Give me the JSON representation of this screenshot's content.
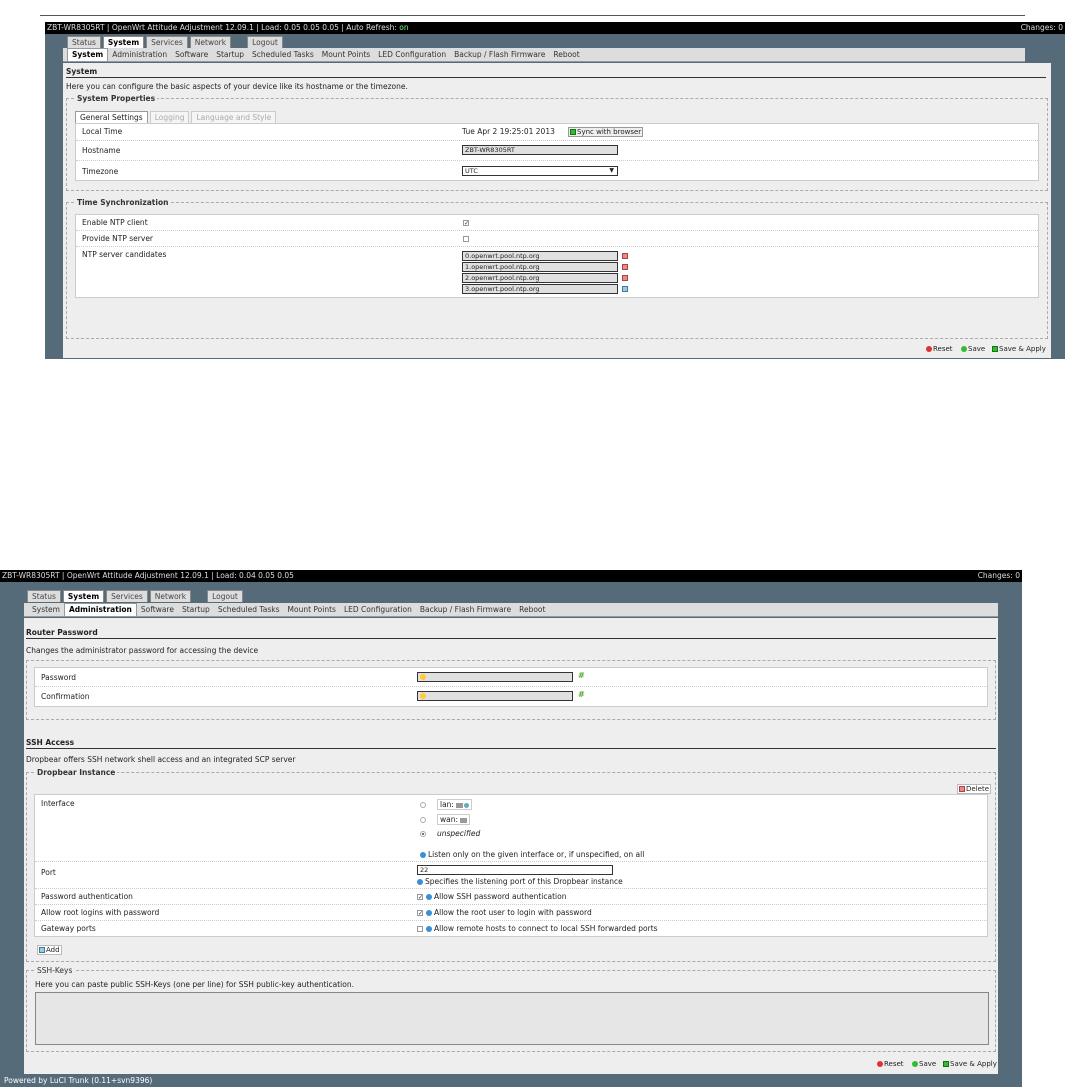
{
  "screen1": {
    "header": {
      "host": "ZBT-WR8305RT",
      "title": "OpenWrt Attitude Adjustment 12.09.1",
      "load": "Load: 0.05 0.05 0.05",
      "auto_refresh_label": "Auto Refresh:",
      "auto_refresh_value": "on",
      "changes": "Changes: 0"
    },
    "main_tabs": [
      "Status",
      "System",
      "Services",
      "Network",
      "Logout"
    ],
    "sub_tabs": [
      "System",
      "Administration",
      "Software",
      "Startup",
      "Scheduled Tasks",
      "Mount Points",
      "LED Configuration",
      "Backup / Flash Firmware",
      "Reboot"
    ],
    "section_title": "System",
    "section_desc": "Here you can configure the basic aspects of your device like its hostname or the timezone.",
    "props_legend": "System Properties",
    "inner_tabs": [
      "General Settings",
      "Logging",
      "Language and Style"
    ],
    "local_time_label": "Local Time",
    "local_time_value": "Tue Apr 2 19:25:01 2013",
    "sync_button": "Sync with browser",
    "hostname_label": "Hostname",
    "hostname_value": "ZBT-WR8305RT",
    "timezone_label": "Timezone",
    "timezone_value": "UTC",
    "time_sync_legend": "Time Synchronization",
    "ntp_client_label": "Enable NTP client",
    "ntp_server_label": "Provide NTP server",
    "ntp_candidates_label": "NTP server candidates",
    "ntp_servers": [
      "0.openwrt.pool.ntp.org",
      "1.openwrt.pool.ntp.org",
      "2.openwrt.pool.ntp.org",
      "3.openwrt.pool.ntp.org"
    ],
    "reset_button": "Reset",
    "save_button": "Save",
    "save_apply_button": "Save & Apply"
  },
  "screen2": {
    "header": {
      "host": "ZBT-WR8305RT",
      "title": "OpenWrt Attitude Adjustment 12.09.1",
      "load": "Load: 0.04 0.05 0.05",
      "changes": "Changes: 0"
    },
    "main_tabs": [
      "Status",
      "System",
      "Services",
      "Network",
      "Logout"
    ],
    "sub_tabs": [
      "System",
      "Administration",
      "Software",
      "Startup",
      "Scheduled Tasks",
      "Mount Points",
      "LED Configuration",
      "Backup / Flash Firmware",
      "Reboot"
    ],
    "pw_title": "Router Password",
    "pw_desc": "Changes the administrator password for accessing the device",
    "password_label": "Password",
    "confirmation_label": "Confirmation",
    "ssh_title": "SSH Access",
    "ssh_desc": "Dropbear offers SSH network shell access and an integrated SCP server",
    "dropbear_legend": "Dropbear Instance",
    "delete_button": "Delete",
    "interface_label": "Interface",
    "iface_lan": "lan:",
    "iface_wan": "wan:",
    "iface_unspecified": "unspecified",
    "iface_hint": "Listen only on the given interface or, if unspecified, on all",
    "port_label": "Port",
    "port_value": "22",
    "port_hint": "Specifies the listening port of this Dropbear instance",
    "pwauth_label": "Password authentication",
    "pwauth_hint": "Allow SSH password authentication",
    "root_label": "Allow root logins with password",
    "root_hint": "Allow the root user to login with password",
    "gateway_label": "Gateway ports",
    "gateway_hint": "Allow remote hosts to connect to local SSH forwarded ports",
    "add_button": "Add",
    "sshkeys_legend": "SSH-Keys",
    "sshkeys_desc": "Here you can paste public SSH-Keys (one per line) for SSH public-key authentication.",
    "reset_button": "Reset",
    "save_button": "Save",
    "save_apply_button": "Save & Apply",
    "footer": "Powered by LuCI Trunk (0.11+svn9396)"
  }
}
